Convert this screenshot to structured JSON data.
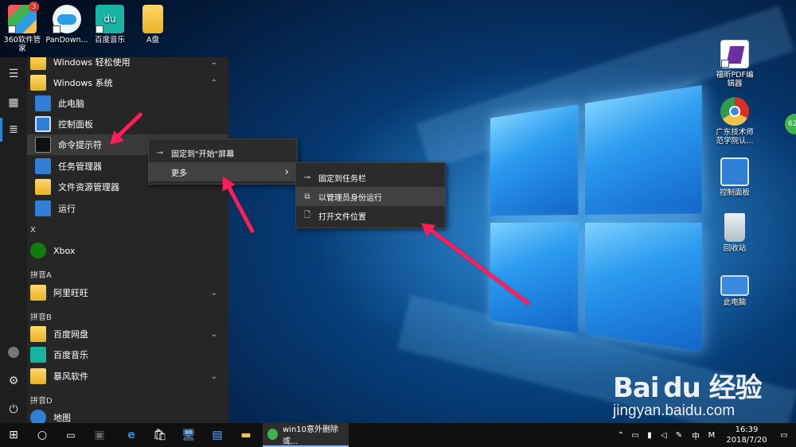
{
  "desktop": {
    "top_icons": [
      {
        "label": "360软件管家",
        "badge": "3",
        "icon": "360-softmgr-icon",
        "color": "#3fb34f"
      },
      {
        "label": "PanDown...",
        "icon": "cloud-icon",
        "color": "#2e9be6"
      },
      {
        "label": "百度音乐",
        "icon": "du-music-icon",
        "color": "#17b3a3"
      },
      {
        "label": "A盘",
        "icon": "folder-icon",
        "color": "#f2c24b"
      }
    ],
    "right_icons": [
      {
        "label": "福昕PDF编辑器",
        "icon": "foxit-pdf-icon",
        "color": "#6b2fa0"
      },
      {
        "label": "广东技术师范学院认...",
        "icon": "chrome-like-icon",
        "color": "#d93025"
      },
      {
        "label": "控制面板",
        "icon": "control-panel-icon",
        "color": "#2f7fd6"
      },
      {
        "label": "回收站",
        "icon": "recycle-bin-icon",
        "color": "#cfd8dc"
      },
      {
        "label": "此电脑",
        "icon": "computer-icon",
        "color": "#3a8be0"
      }
    ],
    "edge_badge": "62"
  },
  "start_menu": {
    "apps": [
      {
        "label": "Windows 轻松使用",
        "type": "folder",
        "chev": "⌄",
        "sub": false
      },
      {
        "label": "Windows 系统",
        "type": "folder",
        "chev": "⌃",
        "sub": false
      },
      {
        "label": "此电脑",
        "type": "computer",
        "sub": true
      },
      {
        "label": "控制面板",
        "type": "control",
        "sub": true
      },
      {
        "label": "命令提示符",
        "type": "cmd",
        "sub": true
      },
      {
        "label": "任务管理器",
        "type": "taskmgr",
        "sub": true
      },
      {
        "label": "文件资源管理器",
        "type": "folder",
        "sub": true
      },
      {
        "label": "运行",
        "type": "run",
        "sub": true
      },
      {
        "label": "Xbox",
        "type": "xbox",
        "sub": false
      },
      {
        "label": "阿里旺旺",
        "type": "folder",
        "chev": "⌄",
        "sub": false
      },
      {
        "label": "百度网盘",
        "type": "folder",
        "chev": "⌄",
        "sub": false
      },
      {
        "label": "百度音乐",
        "type": "music",
        "sub": false
      },
      {
        "label": "暴风软件",
        "type": "folder",
        "chev": "⌄",
        "sub": false
      },
      {
        "label": "地图",
        "type": "map",
        "sub": false
      }
    ],
    "groups": [
      "X",
      "拼音A",
      "拼音B",
      "拼音D"
    ]
  },
  "context_menu": {
    "items": [
      {
        "label": "固定到\"开始\"屏幕",
        "icon": "⊸"
      },
      {
        "label": "更多",
        "icon": "",
        "arrow": "›"
      }
    ]
  },
  "submenu": {
    "items": [
      {
        "label": "固定到任务栏",
        "icon": "⊸"
      },
      {
        "label": "以管理员身份运行",
        "icon": "⧉"
      },
      {
        "label": "打开文件位置",
        "icon": "🗋"
      }
    ]
  },
  "taskbar": {
    "active_app": "win10意外删除或...",
    "time": "16:39",
    "date": "2018/7/20",
    "ime": "中",
    "ime_mode": "M"
  },
  "watermark": {
    "brand": "Bai du 经验",
    "url": "jingyan.baidu.com"
  }
}
